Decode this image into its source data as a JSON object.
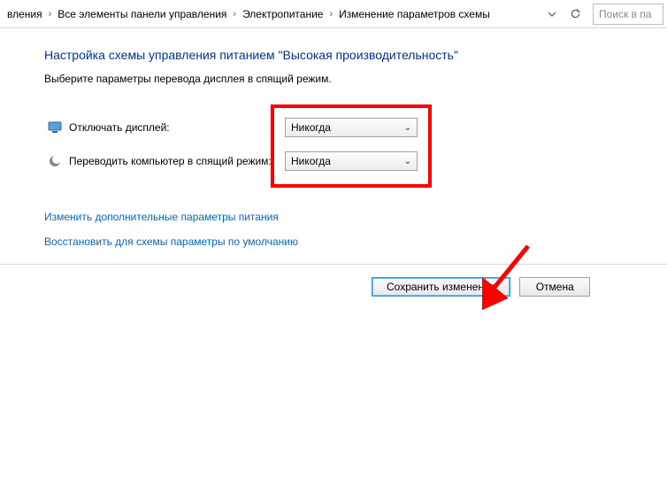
{
  "breadcrumbs": {
    "item0": "вления",
    "item1": "Все элементы панели управления",
    "item2": "Электропитание",
    "item3": "Изменение параметров схемы"
  },
  "search": {
    "placeholder": "Поиск в па"
  },
  "page": {
    "title": "Настройка схемы управления питанием \"Высокая производительность\"",
    "subtitle": "Выберите параметры перевода дисплея в спящий режим."
  },
  "settings": {
    "display_off": {
      "label": "Отключать дисплей:",
      "value": "Никогда"
    },
    "sleep": {
      "label": "Переводить компьютер в спящий режим:",
      "value": "Никогда"
    }
  },
  "links": {
    "advanced": "Изменить дополнительные параметры питания",
    "restore": "Восстановить для схемы параметры по умолчанию"
  },
  "buttons": {
    "save": "Сохранить изменения",
    "cancel": "Отмена"
  }
}
